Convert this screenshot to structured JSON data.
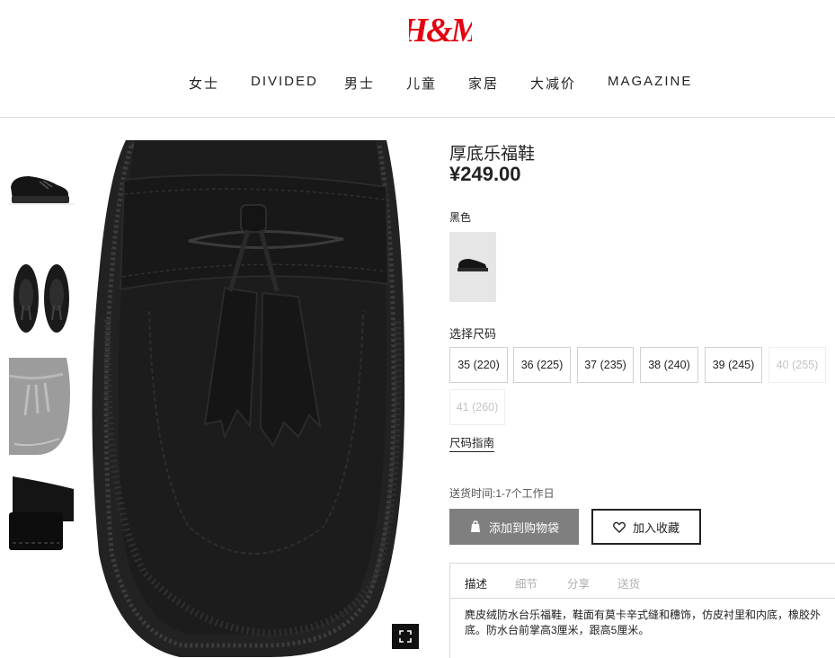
{
  "header": {
    "logo_text": "H&M",
    "brand_color": "#e50010",
    "nav": [
      "女士",
      "DIVIDED",
      "男士",
      "儿童",
      "家居",
      "大减价",
      "MAGAZINE"
    ]
  },
  "product": {
    "title": "厚底乐福鞋",
    "price": "¥249.00",
    "color_name": "黑色",
    "size_label": "选择尺码",
    "sizes": [
      {
        "label": "35 (220)",
        "available": true
      },
      {
        "label": "36 (225)",
        "available": true
      },
      {
        "label": "37 (235)",
        "available": true
      },
      {
        "label": "38 (240)",
        "available": true
      },
      {
        "label": "39 (245)",
        "available": true
      },
      {
        "label": "40 (255)",
        "available": false
      },
      {
        "label": "41 (260)",
        "available": false
      }
    ],
    "size_guide": "尺码指南",
    "delivery": "送货时间:1-7个工作日",
    "add_to_bag": "添加到购物袋",
    "add_to_favorites": "加入收藏",
    "tabs": [
      "描述",
      "细节",
      "分享",
      "送货"
    ],
    "description": "麂皮绒防水台乐福鞋，鞋面有莫卡辛式缝和穗饰，仿皮衬里和内底，橡胶外底。防水台前掌高3厘米，跟高5厘米。"
  },
  "icons": {
    "bag": "shopping-bag-icon",
    "heart": "heart-icon",
    "zoom": "fullscreen-icon"
  }
}
